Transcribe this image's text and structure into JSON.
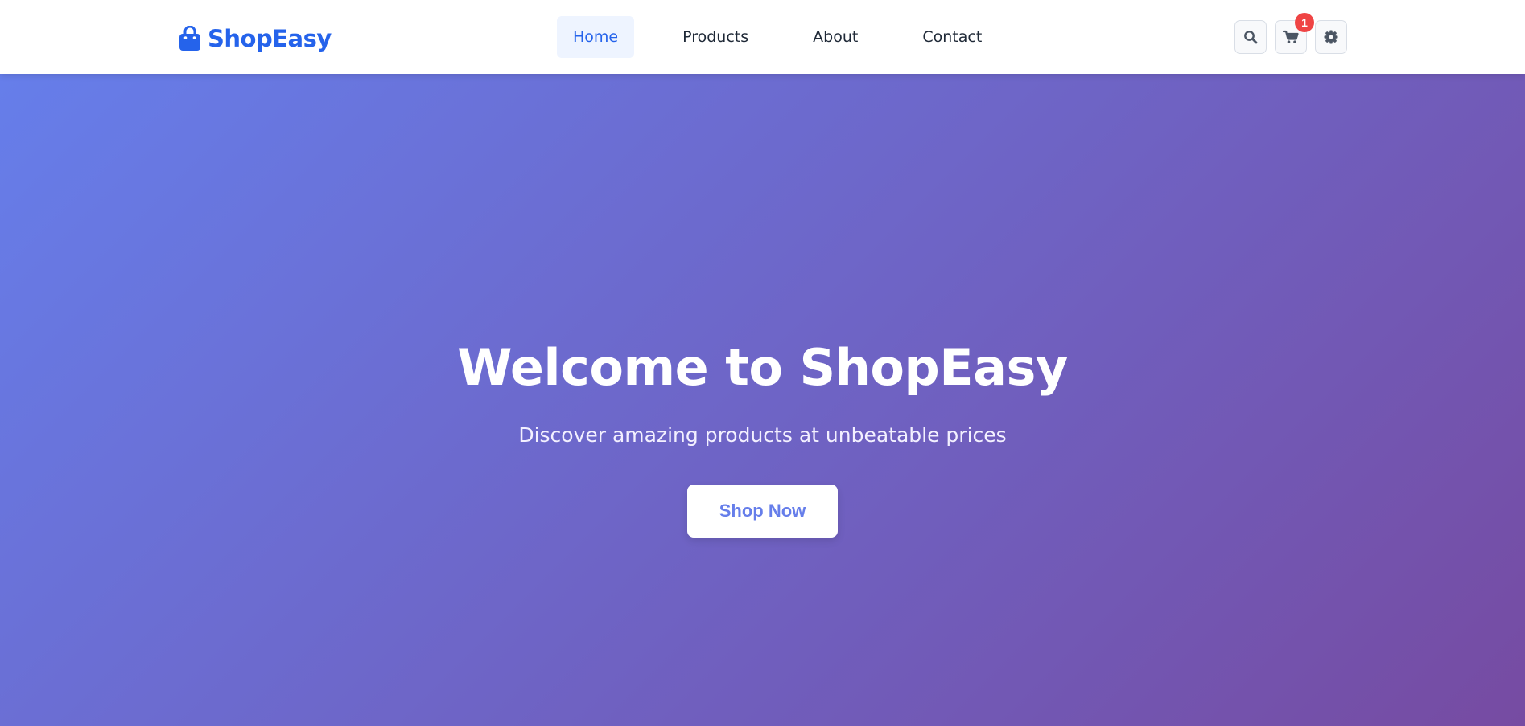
{
  "header": {
    "logo": {
      "icon": "shopping-bag-icon",
      "text": "ShopEasy",
      "color": "#2563eb"
    },
    "nav": [
      {
        "label": "Home",
        "active": true
      },
      {
        "label": "Products",
        "active": false
      },
      {
        "label": "About",
        "active": false
      },
      {
        "label": "Contact",
        "active": false
      }
    ],
    "actions": {
      "search_icon": "search-icon",
      "cart_icon": "cart-icon",
      "cart_count": "1",
      "settings_icon": "gear-icon"
    }
  },
  "hero": {
    "title": "Welcome to ShopEasy",
    "subtitle": "Discover amazing products at unbeatable prices",
    "cta_label": "Shop Now",
    "gradient": [
      "#667eea",
      "#764ba2"
    ]
  },
  "colors": {
    "accent": "#2563eb",
    "active_nav_bg": "#eef4ff",
    "badge": "#ef4444"
  }
}
